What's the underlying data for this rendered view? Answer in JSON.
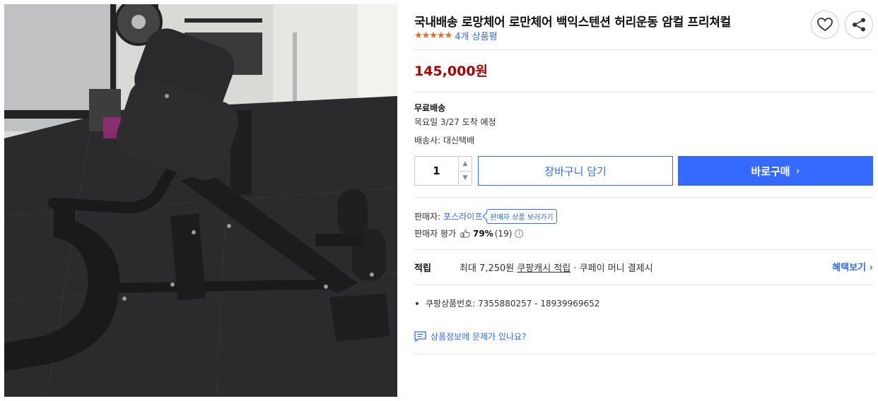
{
  "photo": {
    "alt": "roman chair bench product photo"
  },
  "product": {
    "title": "국내배송 로망체어 로만체어 백익스텐션 허리운동 암컬 프리쳐컬",
    "stars": "★★★★★",
    "review_text": "4개 상품평",
    "price": "145,000원"
  },
  "icons": {
    "wish": "heart-icon",
    "share": "share-icon"
  },
  "shipping": {
    "label": "무료배송",
    "arrival": "목요일 3/27 도착 예정",
    "carrier": "배송사: 대신택배"
  },
  "purchase": {
    "quantity": "1",
    "cart_label": "장바구니 담기",
    "buy_label": "바로구매",
    "buy_chevron": "›"
  },
  "seller": {
    "label": "판매자:",
    "name": "포스라이프",
    "tag": "판매자 상품 보러가기",
    "rating_label": "판매자 평가",
    "rating_pct": "79%",
    "rating_count": "(19)"
  },
  "reward": {
    "label": "적립",
    "text_prefix": "최대 7,250원 ",
    "text_link": "쿠팡캐시 적립",
    "text_suffix": " · 쿠페이 머니 결제시",
    "benefit": "혜택보기 ›"
  },
  "product_id": "쿠팡상품번호: 7355880257 - 18939969652",
  "report": "상품정보에 문제가 있나요?",
  "colors": {
    "accent": "#346aff",
    "price": "#ae0000",
    "star": "#f26522"
  }
}
